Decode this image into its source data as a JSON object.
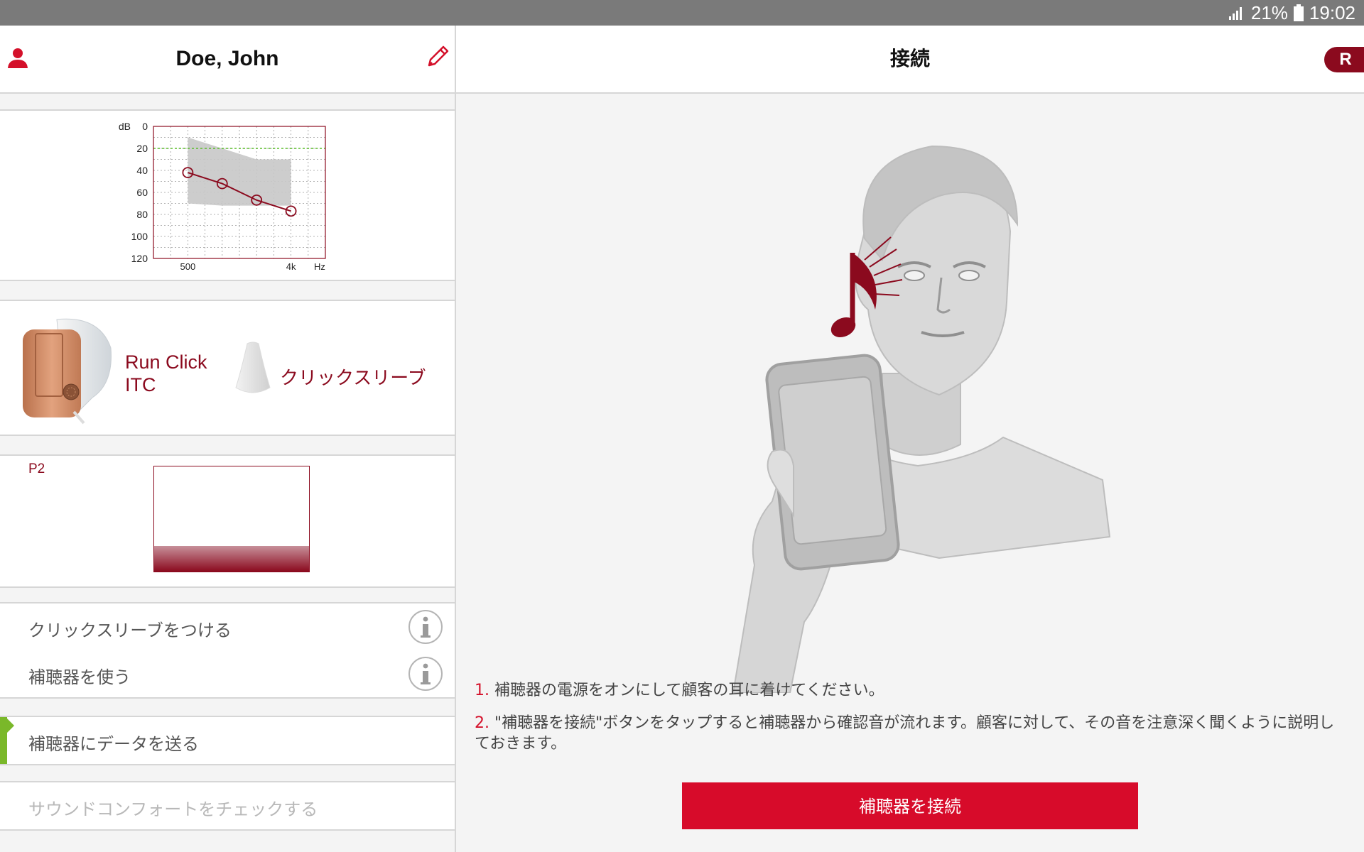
{
  "status_bar": {
    "signal_icon": "signal-icon",
    "battery_percent": "21%",
    "battery_icon": "battery-icon",
    "time": "19:02"
  },
  "left_panel": {
    "header": {
      "patient_name": "Doe, John",
      "user_icon": "user-icon",
      "edit_icon": "pencil-icon"
    },
    "audiogram": {
      "chart_data": {
        "type": "line",
        "y_unit_label": "dB",
        "y_ticks": [
          "0",
          "20",
          "40",
          "60",
          "80",
          "100",
          "120"
        ],
        "ylim": [
          0,
          120
        ],
        "y_inverted": true,
        "x_ticks": [
          "500",
          "4k"
        ],
        "x_unit_label": "Hz",
        "x_scale": "log",
        "xlim": [
          250,
          8000
        ],
        "series": [
          {
            "x": [
              500,
              1000,
              2000,
              4000
            ],
            "y": [
              42,
              52,
              67,
              77
            ],
            "marker": "circle",
            "color": "#8b0a1e"
          }
        ],
        "reference_line_y": 20,
        "reference_line_color": "#5bbf2a",
        "fit_range": {
          "x": [
            500,
            1000,
            2000,
            4000
          ],
          "upper": [
            10,
            20,
            30,
            30
          ],
          "lower": [
            70,
            72,
            72,
            72
          ],
          "color": "#c8c8c8"
        },
        "grid": true
      }
    },
    "device": {
      "model_line1": "Run Click",
      "model_line2": "ITC",
      "sleeve_label": "クリックスリーブ"
    },
    "program": {
      "label": "P2",
      "level_fraction": 0.24
    },
    "steps": [
      {
        "label": "クリックスリーブをつける",
        "icon": "info-icon",
        "state": "normal"
      },
      {
        "label": "補聴器を使う",
        "icon": "info-icon",
        "state": "normal"
      },
      {
        "label": "補聴器にデータを送る",
        "state": "active"
      },
      {
        "label": "サウンドコンフォートをチェックする",
        "state": "disabled"
      }
    ],
    "colors": {
      "brand": "#8b0a1e",
      "active_marker": "#7ab82a",
      "disabled_text": "#b8b8b8"
    }
  },
  "right_panel": {
    "title": "接続",
    "badge": "R",
    "illustration_icon": "person-phone-music-illustration",
    "instructions": [
      {
        "number": "1.",
        "text": "補聴器の電源をオンにして顧客の耳に着けてください。"
      },
      {
        "number": "2.",
        "text": "\"補聴器を接続\"ボタンをタップすると補聴器から確認音が流れます。顧客に対して、その音を注意深く聞くように説明しておきます。"
      }
    ],
    "connect_button": "補聴器を接続",
    "colors": {
      "button": "#d70b2a",
      "step_number": "#d4102a"
    }
  }
}
